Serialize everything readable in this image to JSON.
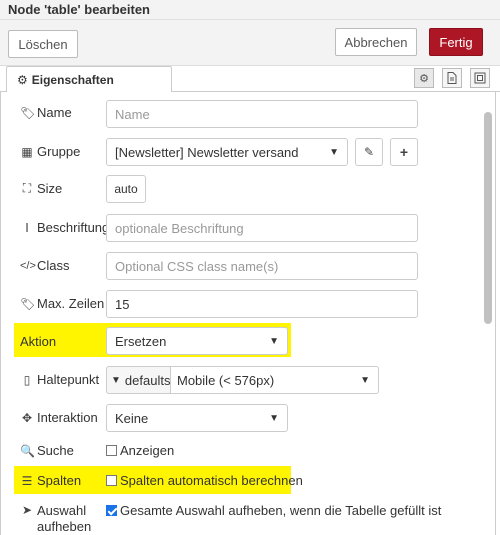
{
  "window": {
    "title": "Node 'table' bearbeiten"
  },
  "toolbar": {
    "delete_label": "Löschen",
    "cancel_label": "Abbrechen",
    "done_label": "Fertig"
  },
  "tabs": {
    "properties_label": "Eigenschaften"
  },
  "form": {
    "name": {
      "label": "Name",
      "placeholder": "Name",
      "value": ""
    },
    "group": {
      "label": "Gruppe",
      "value": "[Newsletter] Newsletter versand"
    },
    "size": {
      "label": "Size",
      "value": "auto"
    },
    "caption": {
      "label": "Beschriftung",
      "placeholder": "optionale Beschriftung"
    },
    "class": {
      "label": "Class",
      "placeholder": "Optional CSS class name(s)"
    },
    "max_rows": {
      "label": "Max. Zeilen",
      "value": "15"
    },
    "action": {
      "label": "Aktion",
      "value": "Ersetzen"
    },
    "breakpoint": {
      "label": "Haltepunkt",
      "type_value": "defaults:",
      "value": "Mobile (< 576px)"
    },
    "interaction": {
      "label": "Interaktion",
      "value": "Keine"
    },
    "search": {
      "label": "Suche",
      "checkbox_label": "Anzeigen",
      "checked": false
    },
    "columns": {
      "label": "Spalten",
      "checkbox_label": "Spalten automatisch berechnen",
      "checked": false
    },
    "deselect": {
      "label_line1": "Auswahl",
      "label_line2": "aufheben",
      "checkbox_label": "Gesamte Auswahl aufheben, wenn die Tabelle gefüllt ist",
      "checked": true
    }
  },
  "colors": {
    "highlight": "#fff500",
    "primary_button": "#ad1625",
    "checkbox_checked": "#1a73e8"
  }
}
